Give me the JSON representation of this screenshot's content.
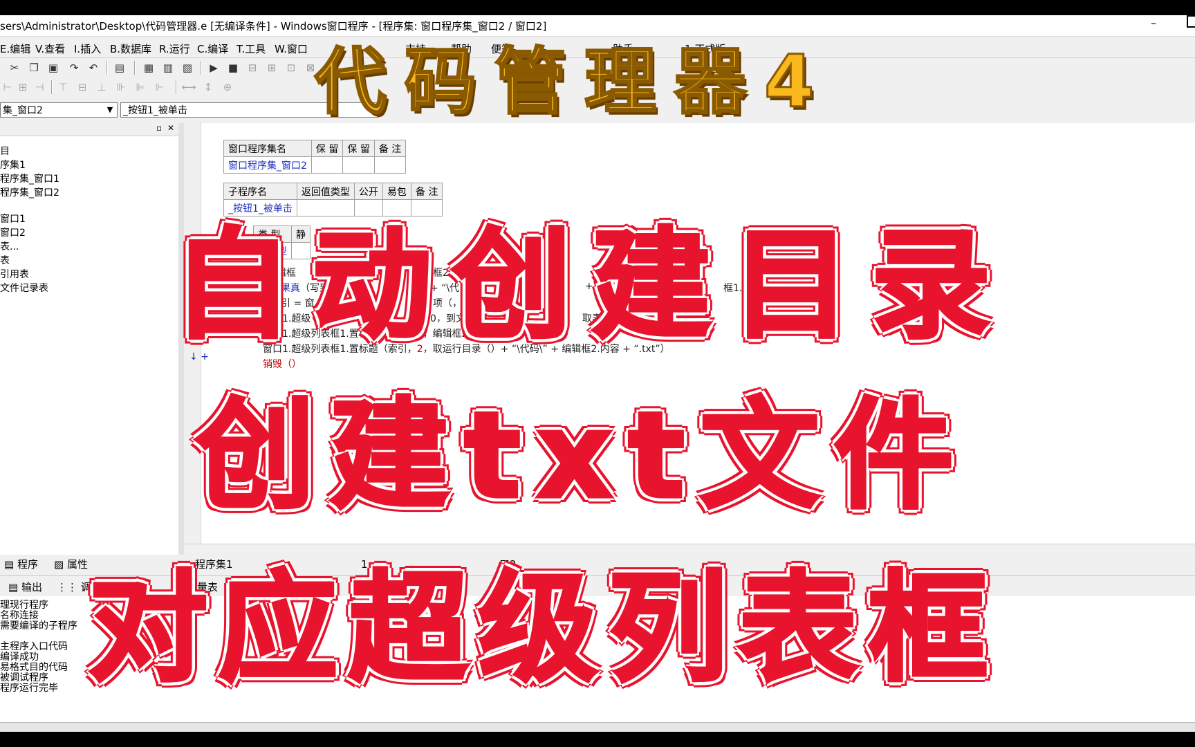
{
  "window": {
    "title": "sers\\Administrator\\Desktop\\代码管理器.e [无编译条件] - Windows窗口程序 - [程序集: 窗口程序集_窗口2 / 窗口2]",
    "minimize": "–"
  },
  "menu": [
    "E.编辑",
    "V.查看",
    "I.插入",
    "B.数据库",
    "R.运行",
    "C.编译",
    "T.工具",
    "W.窗口",
    "支持",
    "帮助",
    "便签",
    "助手",
    "1 正式版"
  ],
  "combos": {
    "left": "集_窗口2",
    "right": "_按钮1_被单击"
  },
  "tree": [
    "目",
    "序集1",
    "程序集_窗口1",
    "程序集_窗口2",
    "窗口1",
    "窗口2",
    "表...",
    "表",
    "引用表",
    "文件记录表"
  ],
  "assembly_table": {
    "headers": [
      "窗口程序集名",
      "保 留",
      "保 留",
      "备 注"
    ],
    "row": [
      "窗口程序集_窗口2",
      "",
      "",
      ""
    ]
  },
  "sub_table": {
    "headers": [
      "子程序名",
      "返回值类型",
      "公开",
      "易包",
      "备 注"
    ],
    "row": [
      "_按钮1_被单击",
      "",
      "",
      "",
      ""
    ]
  },
  "var_table": {
    "headers": [
      "类 型",
      "静"
    ],
    "row": [
      "整数型",
      ""
    ]
  },
  "code": {
    "line1": ".(编辑框",
    "line1b": "框2.内容",
    "line2_kw": "如果真",
    "line2": "（写到",
    "line2b": "+ “\\代",
    "line2c": "+ “",
    "line2d": "框1.内容）",
    "line3": "索引 = 窗",
    "line3b": "项（，",
    "line4": "窗口1.超级",
    "line4b": "0，到文本",
    "line4c": "取表项",
    "line5": "窗口1.超级列表框1.置标题（索引，1，编辑框2.内容）",
    "line6a": "窗口1.超级列表框1.置标题（索引，",
    "line6b": "2，",
    "line6c": "取运行目录（）+ “\\代码\\” + 编辑框2.内容 + “.txt”）",
    "line7": "销毁（）"
  },
  "left_tabs": [
    "程序",
    "属性"
  ],
  "editor_tabs": [
    "程序集1",
    "1",
    "口2"
  ],
  "output_tabs": [
    "输出",
    "调用",
    "变量表",
    "剪辑"
  ],
  "output_lines": [
    "理现行程序",
    "名称连接",
    "需要编译的子程序",
    "",
    "主程序入口代码",
    "编译成功",
    "易格式目的代码",
    "被调试程序",
    "程序运行完毕"
  ],
  "overlay": {
    "top": "代码管理器4",
    "line1": "自动创建目录",
    "line2": "创建txt文件",
    "line3": "对应超级列表框"
  },
  "colors": {
    "overlay_yellow": "#f9b81e",
    "overlay_red": "#e8132c",
    "code_blue": "#1a2bb8",
    "code_red": "#c00000"
  }
}
